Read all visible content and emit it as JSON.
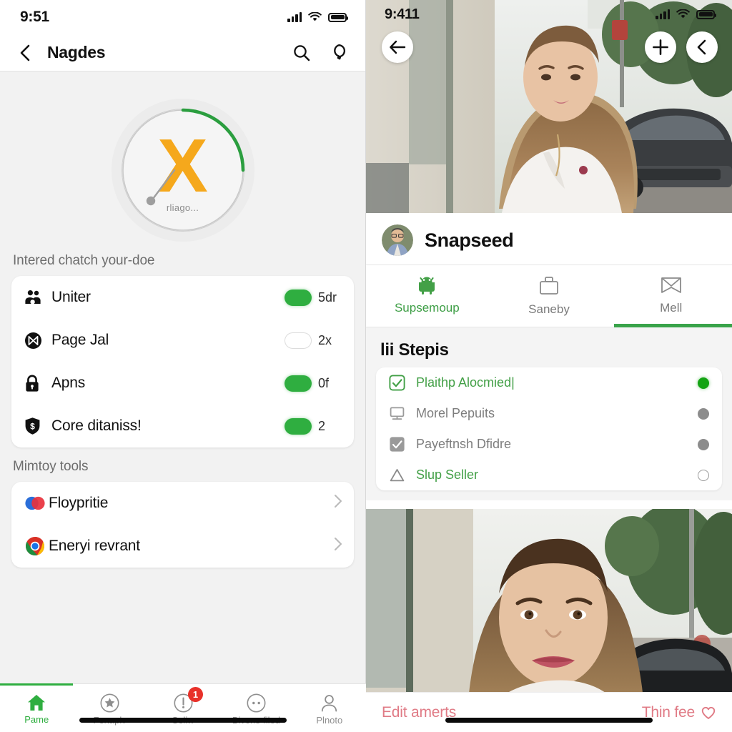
{
  "left": {
    "status": {
      "time": "9:51",
      "signal_icon": "signal-bars-icon",
      "wifi_icon": "wifi-icon",
      "battery_icon": "battery-icon"
    },
    "navbar": {
      "back_icon": "chevron-left-icon",
      "title": "Nagdes",
      "search_icon": "search-icon",
      "pin_icon": "balloon-pin-icon"
    },
    "gauge": {
      "letter": "X",
      "caption": "rliago...",
      "accent": "#f5a81c",
      "arc_color": "#2b9e3f"
    },
    "section_one_label": "Intered chatch your-doe",
    "items": [
      {
        "icon": "people-group-icon",
        "label": "Uniter",
        "toggle": "on",
        "value": "5dr"
      },
      {
        "icon": "circle-bowtie-icon",
        "label": "Page Jal",
        "toggle": "off",
        "value": "2x"
      },
      {
        "icon": "lock-icon",
        "label": "Apns",
        "toggle": "on",
        "value": "0f"
      },
      {
        "icon": "shield-dollar-icon",
        "label": "Core ditaniss!",
        "toggle": "on",
        "value": "2"
      }
    ],
    "section_two_label": "Mimtoy tools",
    "tools": [
      {
        "icon": "mastercard-circles-icon",
        "label": "Floypritie",
        "chevron": "chevron-right-icon"
      },
      {
        "icon": "chrome-icon",
        "label": "Eneryi revrant",
        "chevron": "chevron-right-icon"
      }
    ],
    "tabbar": [
      {
        "icon": "home-icon",
        "label": "Pame",
        "active": true
      },
      {
        "icon": "star-circle-icon",
        "label": "Fenaplv",
        "active": false
      },
      {
        "icon": "alert-circle-icon",
        "label": "Seliw",
        "active": false,
        "badge": "1"
      },
      {
        "icon": "dots-circle-icon",
        "label": "Bivons-filed",
        "active": false
      },
      {
        "icon": "person-icon",
        "label": "Plnoto",
        "active": false
      }
    ]
  },
  "right": {
    "status": {
      "time": "9:411"
    },
    "buttons": {
      "back_icon": "arrow-left-icon",
      "add_icon": "plus-icon",
      "share_icon": "chevron-left-icon"
    },
    "profile": {
      "name": "Snapseed",
      "avatar_icon": "user-avatar-photo"
    },
    "tabs": [
      {
        "icon": "android-robot-icon",
        "label": "Supsemoup",
        "active": true
      },
      {
        "icon": "briefcase-icon",
        "label": "Saneby",
        "active": false
      },
      {
        "icon": "envelope-icon",
        "label": "Mell",
        "active": false,
        "underline": true
      }
    ],
    "list_title": "lii Stepis",
    "list": [
      {
        "icon": "checkbox-checked-green-icon",
        "label": "Plaithp Alocmied|",
        "label_green": true,
        "dot": "green"
      },
      {
        "icon": "monitor-icon",
        "label": "Morel Pepuits",
        "label_green": false,
        "dot": "gray"
      },
      {
        "icon": "checkbox-checked-gray-icon",
        "label": "Payeftnsh Dfidre",
        "label_green": false,
        "dot": "gray"
      },
      {
        "icon": "triangle-icon",
        "label": "Slup Seller",
        "label_green": true,
        "dot": "hollow"
      }
    ],
    "bottom": {
      "left_label": "Edit amerts",
      "right_label": "Thin fee",
      "heart_icon": "heart-icon"
    }
  }
}
